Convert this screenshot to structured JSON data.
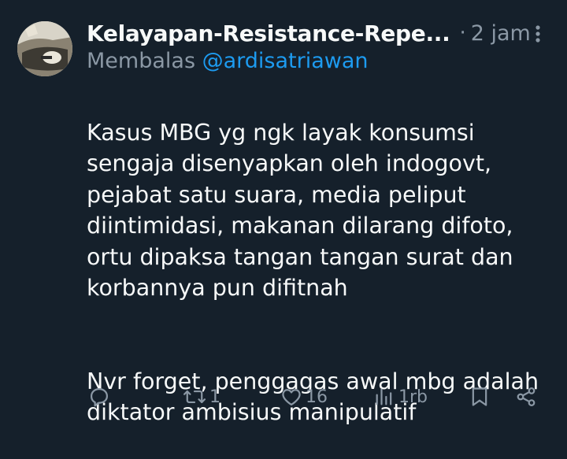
{
  "tweet": {
    "author": {
      "display_name": "Kelayapan-Resistance-Repe...",
      "avatar_icon": "avatar-photo-car-dashboard"
    },
    "separator": "·",
    "timestamp": "2 jam",
    "reply_prefix": "Membalas",
    "reply_to_handle": "@ardisatriawan",
    "paragraph_1": "Kasus MBG yg ngk layak konsumsi\nsengaja disenyapkan oleh indogovt,\npejabat satu suara, media peliput\ndiintimidasi, makanan dilarang difoto,\nortu dipaksa tangan tangan surat dan\nkorbannya pun difitnah",
    "paragraph_2": "Nvr forget, penggagas awal mbg adalah\ndiktator ambisius manipulatif"
  },
  "actions": {
    "reply": {
      "icon": "reply-icon",
      "count": ""
    },
    "repost": {
      "icon": "repost-icon",
      "count": "1"
    },
    "like": {
      "icon": "heart-icon",
      "count": "16"
    },
    "views": {
      "icon": "views-icon",
      "count": "1rb"
    },
    "bookmark": {
      "icon": "bookmark-icon"
    },
    "share": {
      "icon": "share-icon"
    }
  },
  "colors": {
    "background": "#15202b",
    "text_primary": "#f7f9f9",
    "text_secondary": "#8b98a5",
    "link": "#1d9bf0"
  }
}
